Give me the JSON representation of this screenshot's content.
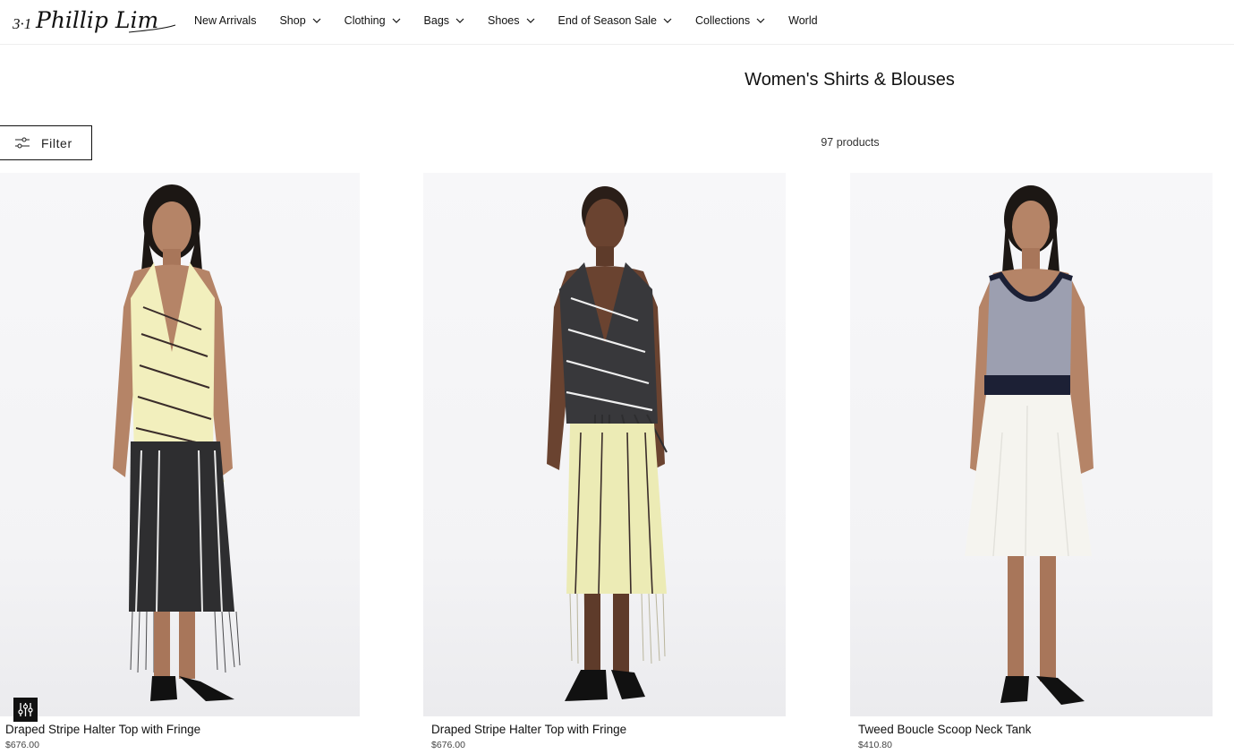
{
  "brand": {
    "logo_text": "3.1 Phillip Lim"
  },
  "nav": [
    {
      "label": "New Arrivals",
      "has_dropdown": false
    },
    {
      "label": "Shop",
      "has_dropdown": true
    },
    {
      "label": "Clothing",
      "has_dropdown": true
    },
    {
      "label": "Bags",
      "has_dropdown": true
    },
    {
      "label": "Shoes",
      "has_dropdown": true
    },
    {
      "label": "End of Season Sale",
      "has_dropdown": true
    },
    {
      "label": "Collections",
      "has_dropdown": true
    },
    {
      "label": "World",
      "has_dropdown": false
    }
  ],
  "page": {
    "title": "Women's Shirts & Blouses",
    "product_count": "97 products"
  },
  "filter": {
    "label": "Filter",
    "icon": "sliders-icon"
  },
  "products": [
    {
      "name": "Draped Stripe Halter Top with Fringe",
      "price": "$676.00",
      "image": "model in cream striped halter top with black striped skirt"
    },
    {
      "name": "Draped Stripe Halter Top with Fringe",
      "price": "$676.00",
      "image": "model in black striped halter top with cream striped skirt"
    },
    {
      "name": "Tweed Boucle Scoop Neck Tank",
      "price": "$410.80",
      "image": "model in tweed scoop neck tank with white skirt"
    }
  ],
  "accessibility": {
    "icon": "accessibility-settings-icon"
  },
  "colors": {
    "text": "#111111",
    "border": "#111111",
    "background": "#ffffff"
  }
}
